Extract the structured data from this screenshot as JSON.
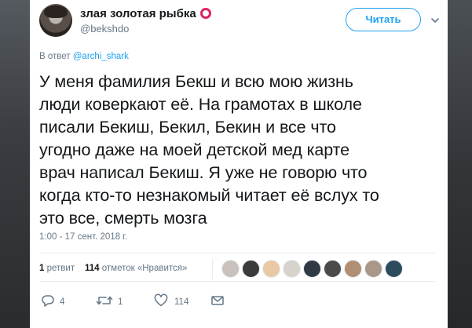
{
  "user": {
    "display_name": "злая золотая рыбка",
    "handle": "@bekshdo",
    "name_emoji": "red-circle-icon"
  },
  "follow_button": {
    "label": "Читать"
  },
  "reply": {
    "prefix": "В ответ",
    "mention": "@archi_shark"
  },
  "tweet": {
    "lines": [
      "У меня фамилия Бекш и всю мою жизнь",
      "люди коверкают её. На грамотах в школе",
      "писали Бекиш, Бекил, Бекин и все что",
      "угодно даже на моей детской мед карте",
      "врач написал Бекиш. Я уже не говорю что",
      "когда кто-то незнакомый читает её вслух то",
      "это все, смерть мозга"
    ]
  },
  "timestamp": "1:00 - 17 сент. 2018 г.",
  "stats": {
    "retweets_count": "1",
    "retweets_label": "ретвит",
    "likes_count": "114",
    "likes_label": "отметок «Нравится»"
  },
  "likers": [
    {
      "color": "#c9c2bc"
    },
    {
      "color": "#3b3b3b"
    },
    {
      "color": "#e9c9a4"
    },
    {
      "color": "#d8d2cc"
    },
    {
      "color": "#2f3a45"
    },
    {
      "color": "#4a4a4a"
    },
    {
      "color": "#b08f74"
    },
    {
      "color": "#a99889"
    },
    {
      "color": "#2c4c5e"
    }
  ],
  "actions": {
    "reply_count": "4",
    "retweet_count": "1",
    "like_count": "114"
  },
  "colors": {
    "accent": "#1da1f2",
    "secondary_text": "#657786",
    "primary_text": "#14171a",
    "emoji_ring": "#e0245e"
  }
}
